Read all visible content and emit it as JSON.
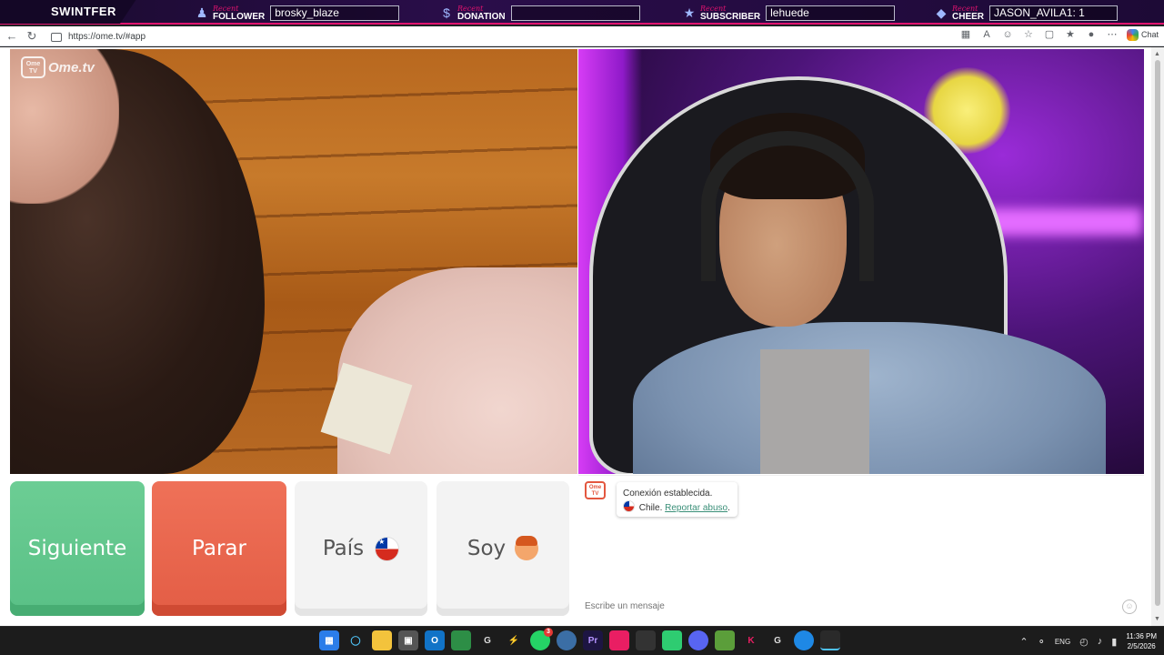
{
  "overlay": {
    "brand": "SWINTFER",
    "items": [
      {
        "recent": "Recent",
        "type": "FOLLOWER",
        "value": "brosky_blaze",
        "icon": "person-icon"
      },
      {
        "recent": "Recent",
        "type": "DONATION",
        "value": "",
        "icon": "dollar-icon"
      },
      {
        "recent": "Recent",
        "type": "SUBSCRIBER",
        "value": "lehuede",
        "icon": "star-icon"
      },
      {
        "recent": "Recent",
        "type": "CHEER",
        "value": "JASON_AVILA1: 1",
        "icon": "diamond-icon"
      }
    ],
    "accent": "#e0136f"
  },
  "browser": {
    "url": "https://ome.tv/#app",
    "chat_label": "Chat"
  },
  "video": {
    "logo_badge": "Ome TV",
    "logo_text": "Ome.tv"
  },
  "controls": {
    "next_label": "Siguiente",
    "stop_label": "Parar",
    "country_label": "País",
    "gender_label": "Soy",
    "next_color": "#5ec48a",
    "stop_color": "#e8644b"
  },
  "chat": {
    "status": "Conexión establecida.",
    "country": "Chile.",
    "report_link": "Reportar abuso",
    "report_suffix": ".",
    "input_placeholder": "Escribe un mensaje"
  },
  "taskbar": {
    "lang": "ENG",
    "time": "11:36 PM",
    "date": "2/5/2026",
    "whatsapp_badge": "3"
  }
}
